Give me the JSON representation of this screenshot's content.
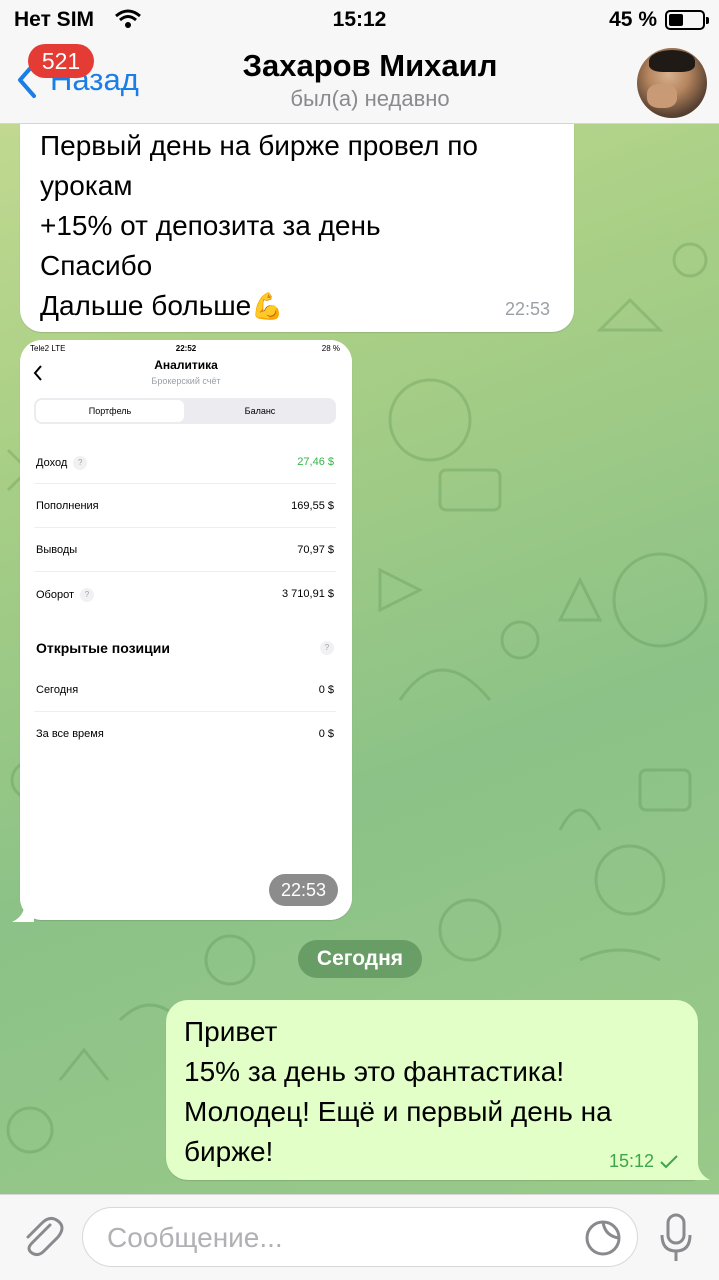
{
  "status_bar": {
    "carrier": "Нет SIM",
    "time": "15:12",
    "battery_percent": "45 %",
    "battery_level": 0.45
  },
  "header": {
    "back_label": "Назад",
    "unread_count": "521",
    "title": "Захаров Михаил",
    "subtitle": "был(а) недавно"
  },
  "messages": [
    {
      "direction": "incoming",
      "text": "Первый день на бирже провел по\nурокам\n+15% от депозита за день\nСпасибо\nДальше больше",
      "emoji": "💪",
      "time": "22:53"
    },
    {
      "direction": "incoming",
      "type": "photo",
      "time": "22:53",
      "photo": {
        "status_left": "Tele2  LTE",
        "status_time": "22:52",
        "status_right": "28 %",
        "title": "Аналитика",
        "subtitle": "Брокерский счёт",
        "segments": [
          "Портфель",
          "Баланс"
        ],
        "rows": [
          {
            "label": "Доход",
            "value": "27,46 $",
            "help": "?"
          },
          {
            "label": "Пополнения",
            "value": "169,55 $"
          },
          {
            "label": "Выводы",
            "value": "70,97 $"
          },
          {
            "label": "Оборот",
            "value": "3 710,91 $",
            "help": "?"
          }
        ],
        "section_title": "Открытые позиции",
        "section_help": "?",
        "section_rows": [
          {
            "label": "Сегодня",
            "value": "0 $"
          },
          {
            "label": "За все время",
            "value": "0 $"
          }
        ]
      }
    },
    {
      "direction": "outgoing",
      "text": "Привет\n15% за день это фантастика!\nМолодец! Ещё и первый день на\nбирже!",
      "time": "15:12"
    }
  ],
  "date_separator": "Сегодня",
  "composer": {
    "placeholder": "Сообщение..."
  },
  "colors": {
    "accent": "#1a7ee8",
    "badge": "#e53b35",
    "outgoing_bubble": "#e1ffc7",
    "income_green": "#35b54a"
  }
}
